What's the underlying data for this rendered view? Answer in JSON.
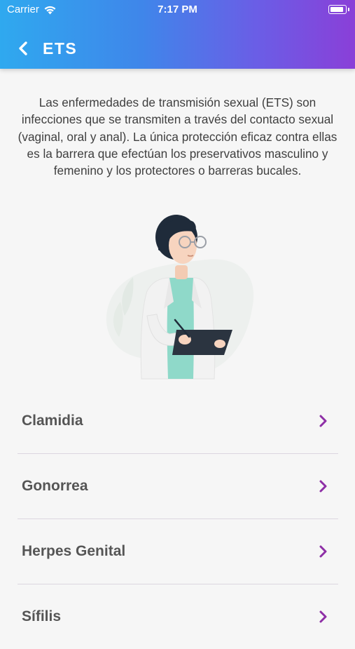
{
  "status_bar": {
    "carrier": "Carrier",
    "time": "7:17 PM"
  },
  "header": {
    "title": "ETS",
    "back_icon": "chevron-left-icon"
  },
  "description": "Las enfermedades de transmisión sexual (ETS) son infecciones que se transmiten a través del contacto sexual (vaginal, oral y anal). La única protección eficaz contra ellas es la barrera que efectúan los preservativos masculino y femenino y los protectores o barreras bucales.",
  "diseases": [
    {
      "label": "Clamidia"
    },
    {
      "label": "Gonorrea"
    },
    {
      "label": "Herpes Genital"
    },
    {
      "label": "Sífilis"
    }
  ],
  "colors": {
    "header_gradient": [
      "#2fa9ef",
      "#3f86ea",
      "#6a5ee6",
      "#8a3fd8"
    ],
    "chevron": "#8e2fa6",
    "background": "#f6f6f6"
  }
}
